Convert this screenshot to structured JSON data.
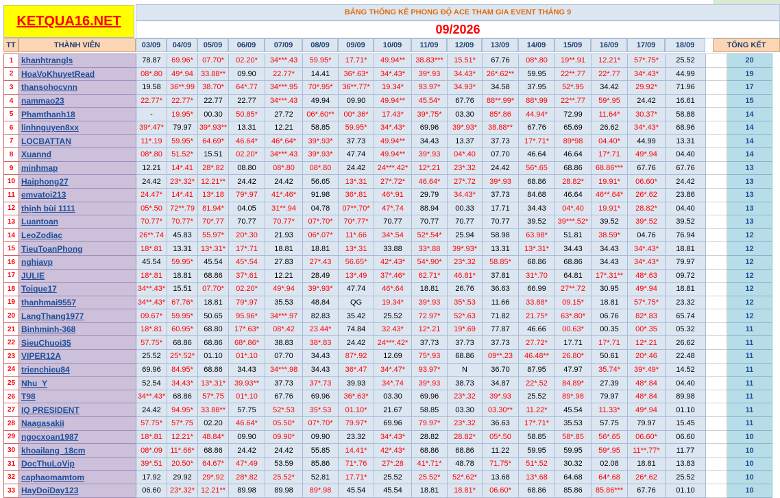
{
  "logo_text": "KETQUA16.NET",
  "title": "BẢNG THỐNG KÊ PHONG ĐỘ ACE THAM GIA EVENT THÁNG 9",
  "month": "09/2026",
  "headers": {
    "tt": "TT",
    "member": "THÀNH VIÊN",
    "total": "TỔNG KẾT"
  },
  "dates": [
    "03/09",
    "04/09",
    "05/09",
    "06/09",
    "07/09",
    "08/09",
    "09/09",
    "10/09",
    "11/09",
    "12/09",
    "13/09",
    "14/09",
    "15/09",
    "16/09",
    "17/09",
    "18/09"
  ],
  "colors": {
    "highlight_text": "#ff0000",
    "name_bg": "#ccc0da",
    "cell_bg": "#dce6f1",
    "total_bg": "#b7dee8"
  },
  "rows": [
    {
      "tt": "1",
      "name": "khanhtrangls",
      "cells": [
        "78.87",
        "69.96*",
        "07.70*",
        "02.20*",
        "34***.43",
        "59.95*",
        "17.71*",
        "49.94**",
        "38.83***",
        "15.51*",
        "67.76",
        "08*.80",
        "19**.91",
        "12.21*",
        "57*.75*",
        "25.52"
      ],
      "total": "20"
    },
    {
      "tt": "2",
      "name": "HoaVoKhuyetRead",
      "cells": [
        "08*.80",
        "49*.94",
        "33.88**",
        "09.90",
        "22.77*",
        "14.41",
        "36*.63*",
        "34*.43*",
        "39*.93",
        "34.43*",
        "26*.62**",
        "59.95",
        "22**.77",
        "22*.77",
        "34*.43*",
        "44.99"
      ],
      "total": "19"
    },
    {
      "tt": "3",
      "name": "thansohocvnn",
      "cells": [
        "19.58",
        "36**.99",
        "38.70*",
        "64*.77",
        "34***.95",
        "70*.95*",
        "36**.77*",
        "19.34*",
        "93.97*",
        "34.93*",
        "34.58",
        "37.95",
        "52*.95",
        "34.42",
        "29.92*",
        "71.96"
      ],
      "total": "17"
    },
    {
      "tt": "4",
      "name": "nammao23",
      "cells": [
        "22.77*",
        "22.77*",
        "22.77",
        "22.77",
        "34***.43",
        "49.94",
        "09.90",
        "49.94**",
        "45.54*",
        "67.76",
        "88**.99*",
        "88*.99",
        "22**.77",
        "59*.95",
        "24.42",
        "16.61"
      ],
      "total": "15"
    },
    {
      "tt": "5",
      "name": "Phamthanh18",
      "cells": [
        "-",
        "19.95*",
        "00.30",
        "50.85*",
        "27.72",
        "06*.60**",
        "00*.36*",
        "17.43*",
        "39*.75*",
        "03.30",
        "85*.86",
        "44.94*",
        "72.99",
        "11.64*",
        "30.37*",
        "58.88"
      ],
      "total": "14"
    },
    {
      "tt": "6",
      "name": "linhnguyen8xx",
      "cells": [
        "39*.47*",
        "79.97",
        "39*.93**",
        "13.31",
        "12.21",
        "58.85",
        "59.95*",
        "34*.43*",
        "69.96",
        "39*.93*",
        "38.88**",
        "67.76",
        "65.69",
        "26.62",
        "34*.43*",
        "68.96"
      ],
      "total": "14"
    },
    {
      "tt": "7",
      "name": "LOCBATTAN",
      "cells": [
        "11*.19",
        "59.95*",
        "64.69*",
        "46.64*",
        "46*.64*",
        "39*.93*",
        "37.73",
        "49.94**",
        "34.43",
        "13.37",
        "37.73",
        "17*.71*",
        "89*98",
        "04.40*",
        "44.99",
        "13.31"
      ],
      "total": "14"
    },
    {
      "tt": "8",
      "name": "Xuannd",
      "cells": [
        "08*.80",
        "51.52*",
        "15.51",
        "02.20*",
        "34***.43",
        "39*.93*",
        "47.74",
        "49.94**",
        "39*.93",
        "04*.40",
        "07.70",
        "46.64",
        "46.64",
        "17*.71",
        "49*.94",
        "04.40"
      ],
      "total": "14"
    },
    {
      "tt": "9",
      "name": "minhmap",
      "cells": [
        "12.21",
        "14*.41",
        "28*.82",
        "08.80",
        "08*.80",
        "08*.80",
        "24.42",
        "24***.42*",
        "12*.21",
        "23*.32",
        "24.42",
        "56*.65",
        "68.86",
        "68.86***",
        "67.76",
        "67.76"
      ],
      "total": "13"
    },
    {
      "tt": "10",
      "name": "Haiphong27",
      "cells": [
        "24.42",
        "23*.32*",
        "12.21**",
        "24.42",
        "24.42",
        "56.65",
        "13*.31",
        "27*.72*",
        "46.64*",
        "27*.72",
        "39*.93",
        "68.86",
        "28.82*",
        "19.91*",
        "06.60*",
        "24.42"
      ],
      "total": "13"
    },
    {
      "tt": "11",
      "name": "emvatoi213",
      "cells": [
        "24.47*",
        "14*.41",
        "13*.18",
        "79*.97",
        "41*.46*",
        "91.98",
        "36*.81",
        "46*.91",
        "29.79",
        "34.43*",
        "37.73",
        "84.68",
        "46.64",
        "46**.64*",
        "26*.62",
        "23.86"
      ],
      "total": "13"
    },
    {
      "tt": "12",
      "name": "thịnh bùi 1111",
      "cells": [
        "05*.50",
        "72**.79",
        "81.94*",
        "04.05",
        "31**.94",
        "04.78",
        "07**.70*",
        "47*.74",
        "88.94",
        "00.33",
        "17.71",
        "34.43",
        "04*.40",
        "19.91*",
        "28.82*",
        "04.40"
      ],
      "total": "13"
    },
    {
      "tt": "13",
      "name": "Luantoan",
      "cells": [
        "70.77*",
        "70.77*",
        "70*.77",
        "70.77",
        "70.77*",
        "07*.70*",
        "70*.77*",
        "70.77",
        "70.77",
        "70.77",
        "70.77",
        "39.52",
        "39***.52*",
        "39.52",
        "39*.52",
        "39.52"
      ],
      "total": "13"
    },
    {
      "tt": "14",
      "name": "LeoZodiac",
      "cells": [
        "26**.74",
        "45.83",
        "55.97*",
        "20*.30",
        "21.93",
        "06*.07*",
        "11*.66",
        "34*.54",
        "52*.54*",
        "25.94",
        "58.98",
        "63.98*",
        "51.81",
        "38.59*",
        "04.76",
        "76.94"
      ],
      "total": "12"
    },
    {
      "tt": "15",
      "name": "TieuToanPhong",
      "cells": [
        "18*.81",
        "13.31",
        "13*.31*",
        "17*.71",
        "18.81",
        "18.81",
        "13*.31",
        "33.88",
        "33*.88",
        "39*.93*",
        "13.31",
        "13*.31*",
        "34.43",
        "34.43",
        "34*.43*",
        "18.81"
      ],
      "total": "12"
    },
    {
      "tt": "16",
      "name": "nghiavp",
      "cells": [
        "45.54",
        "59.95*",
        "45.54",
        "45*.54",
        "27.83",
        "27*.43",
        "56.65*",
        "42*.43*",
        "54*.90*",
        "23*.32",
        "58.85*",
        "68.86",
        "68.86",
        "34.43",
        "34*.43*",
        "79.97"
      ],
      "total": "12"
    },
    {
      "tt": "17",
      "name": "JULIE",
      "cells": [
        "18*.81",
        "18.81",
        "68.86",
        "37*.61",
        "12.21",
        "28.49",
        "13*.49",
        "37*.46*",
        "62.71*",
        "46.81*",
        "37.81",
        "31*.70",
        "64.81",
        "17*.31**",
        "48*.63",
        "09.72"
      ],
      "total": "12"
    },
    {
      "tt": "18",
      "name": "Toique17",
      "cells": [
        "34**.43*",
        "15.51",
        "07.70*",
        "02.20*",
        "49*.94",
        "39*.93*",
        "47.74",
        "46*.64",
        "18.81",
        "26.76",
        "36.63",
        "66.99",
        "27**.72",
        "30.95",
        "49*.94",
        "18.81"
      ],
      "total": "12"
    },
    {
      "tt": "19",
      "name": "thanhmai9557",
      "cells": [
        "34**.43*",
        "67.76*",
        "18.81",
        "79*.97",
        "35.53",
        "48.84",
        "QG",
        "19.34*",
        "39*.93",
        "35*.53",
        "11.66",
        "33.88*",
        "09.15*",
        "18.81",
        "57*.75*",
        "23.32"
      ],
      "total": "12"
    },
    {
      "tt": "20",
      "name": "LangThang1977",
      "cells": [
        "09.67*",
        "59.95*",
        "50.65",
        "95.96*",
        "34***.97",
        "82.83",
        "35.42",
        "25.52",
        "72.97*",
        "52*.63",
        "71.82",
        "21.75*",
        "63*.80*",
        "06.76",
        "82*.83",
        "65.74"
      ],
      "total": "12"
    },
    {
      "tt": "21",
      "name": "Binhminh-368",
      "cells": [
        "18*.81",
        "60.95*",
        "68.80",
        "17*.63*",
        "08*.42",
        "23.44*",
        "74.84",
        "32.43*",
        "12*.21",
        "19*.69",
        "77.87",
        "46.66",
        "00.63*",
        "00.35",
        "00*.35",
        "05.32"
      ],
      "total": "11"
    },
    {
      "tt": "22",
      "name": "SieuChuoi35",
      "cells": [
        "57.75*",
        "68.86",
        "68.86",
        "68*.86*",
        "38.83",
        "38*.83",
        "24.42",
        "24***.42*",
        "37.73",
        "37.73",
        "37.73",
        "27.72*",
        "17.71",
        "17*.71",
        "12*.21",
        "26.62"
      ],
      "total": "11"
    },
    {
      "tt": "23",
      "name": "VIPER12A",
      "cells": [
        "25.52",
        "25*.52*",
        "01.10",
        "01*.10",
        "07.70",
        "34.43",
        "87*.92",
        "12.69",
        "75*.93",
        "68.86",
        "09**.23",
        "46.48**",
        "26.80*",
        "50.61",
        "20*.46",
        "22.48"
      ],
      "total": "11"
    },
    {
      "tt": "24",
      "name": "trienchieu84",
      "cells": [
        "69.96",
        "84.95*",
        "68.86",
        "34.43",
        "34***.98",
        "34.43",
        "36*.47",
        "34*.47*",
        "93.97*",
        "N",
        "36.70",
        "87.95",
        "47.97",
        "35.74*",
        "39*.49*",
        "14.52"
      ],
      "total": "11"
    },
    {
      "tt": "25",
      "name": "Nhu_Y",
      "cells": [
        "52.54",
        "34.43*",
        "13*.31*",
        "39.93**",
        "37.73",
        "37*.73",
        "39.93",
        "34*.74",
        "39*.93",
        "38.73",
        "34.87",
        "22*.52",
        "84.89*",
        "27.39",
        "48*.84",
        "04.40"
      ],
      "total": "11"
    },
    {
      "tt": "26",
      "name": "T98",
      "cells": [
        "34**.43*",
        "68.86",
        "57*.75",
        "01*.10",
        "67.76",
        "69.96",
        "36*.63*",
        "03.30",
        "69.96",
        "23*.32",
        "39*.93",
        "25.52",
        "89*.98",
        "79.97",
        "48*.84",
        "89.98"
      ],
      "total": "11"
    },
    {
      "tt": "27",
      "name": "IQ PRESIDENT",
      "cells": [
        "24.42",
        "94.95*",
        "33.88**",
        "57.75",
        "52*.53",
        "35*.53",
        "01.10*",
        "21.67",
        "58.85",
        "03.30",
        "03.30**",
        "11.22*",
        "45.54",
        "11.33*",
        "49*.94",
        "01.10"
      ],
      "total": "11"
    },
    {
      "tt": "28",
      "name": "Naagasakii",
      "cells": [
        "57.75*",
        "57*.75",
        "02.20",
        "46.64*",
        "05.50*",
        "07*.70*",
        "79.97*",
        "69.96",
        "79.97*",
        "23*.32",
        "36.63",
        "17*.71*",
        "35.53",
        "57.75",
        "79.97",
        "15.45"
      ],
      "total": "11"
    },
    {
      "tt": "29",
      "name": "ngocxoan1987",
      "cells": [
        "18*.81",
        "12.21*",
        "48.84*",
        "09.90",
        "09.90*",
        "09.90",
        "23.32",
        "34*.43*",
        "28.82",
        "28.82*",
        "05*.50",
        "58.85",
        "58*.85",
        "56*.65",
        "06.60*",
        "06.60"
      ],
      "total": "10"
    },
    {
      "tt": "30",
      "name": "khoailang_18cm",
      "cells": [
        "08*.09",
        "11*.66*",
        "68.86",
        "24.42",
        "24.42",
        "55.85",
        "14.41*",
        "42*.43*",
        "68.86",
        "68.86",
        "11.22",
        "59.95",
        "59.95",
        "59*.95",
        "11**.77*",
        "11.77"
      ],
      "total": "10"
    },
    {
      "tt": "31",
      "name": "DocThuLoVip",
      "cells": [
        "39*.51",
        "20.50*",
        "64.67*",
        "47*.49",
        "53.59",
        "85.86",
        "71*.76",
        "27*.28",
        "41*.71*",
        "48.78",
        "71.75*",
        "51*.52",
        "30.32",
        "02.08",
        "18.81",
        "13.83"
      ],
      "total": "10"
    },
    {
      "tt": "32",
      "name": "caphaomamtom",
      "cells": [
        "17.92",
        "29.92",
        "29*.92",
        "28*.82",
        "25.52*",
        "52.81",
        "17.71*",
        "25.52",
        "25.52*",
        "52*.62*",
        "13.68",
        "13*.68",
        "64.68",
        "64*.68",
        "26*.62",
        "25.52"
      ],
      "total": "10"
    },
    {
      "tt": "33",
      "name": "HayDoiDay123",
      "cells": [
        "06.60",
        "23*.32*",
        "12.21**",
        "89.98",
        "89.98",
        "89*.98",
        "45.54",
        "45.54",
        "18.81",
        "18.81*",
        "06.60*",
        "68.86",
        "85.86",
        "85.86***",
        "67.76",
        "01.10"
      ],
      "total": "10"
    }
  ]
}
